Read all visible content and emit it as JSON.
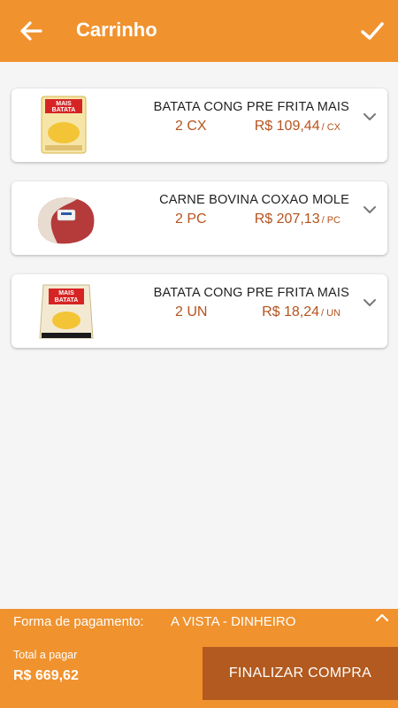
{
  "header": {
    "title": "Carrinho"
  },
  "cart": {
    "items": [
      {
        "name": "BATATA CONG PRE FRITA MAIS",
        "qty": "2 CX",
        "price": "R$ 109,44",
        "unit": "/ CX",
        "image_icon": "potato-bag-image"
      },
      {
        "name": "CARNE BOVINA COXAO MOLE",
        "qty": "2 PC",
        "price": "R$ 207,13",
        "unit": "/ PC",
        "image_icon": "beef-cut-image"
      },
      {
        "name": "BATATA CONG PRE FRITA MAIS",
        "qty": "2 UN",
        "price": "R$ 18,24",
        "unit": "/ UN",
        "image_icon": "potato-bag-image"
      }
    ]
  },
  "footer": {
    "payment_label": "Forma de pagamento:",
    "payment_value": "A VISTA - DINHEIRO",
    "total_label": "Total a pagar",
    "total_value": "R$ 669,62",
    "finish_label": "FINALIZAR COMPRA"
  },
  "colors": {
    "primary": "#f0922e",
    "button_dark": "#b25a1f",
    "accent_text": "#b5531e"
  }
}
